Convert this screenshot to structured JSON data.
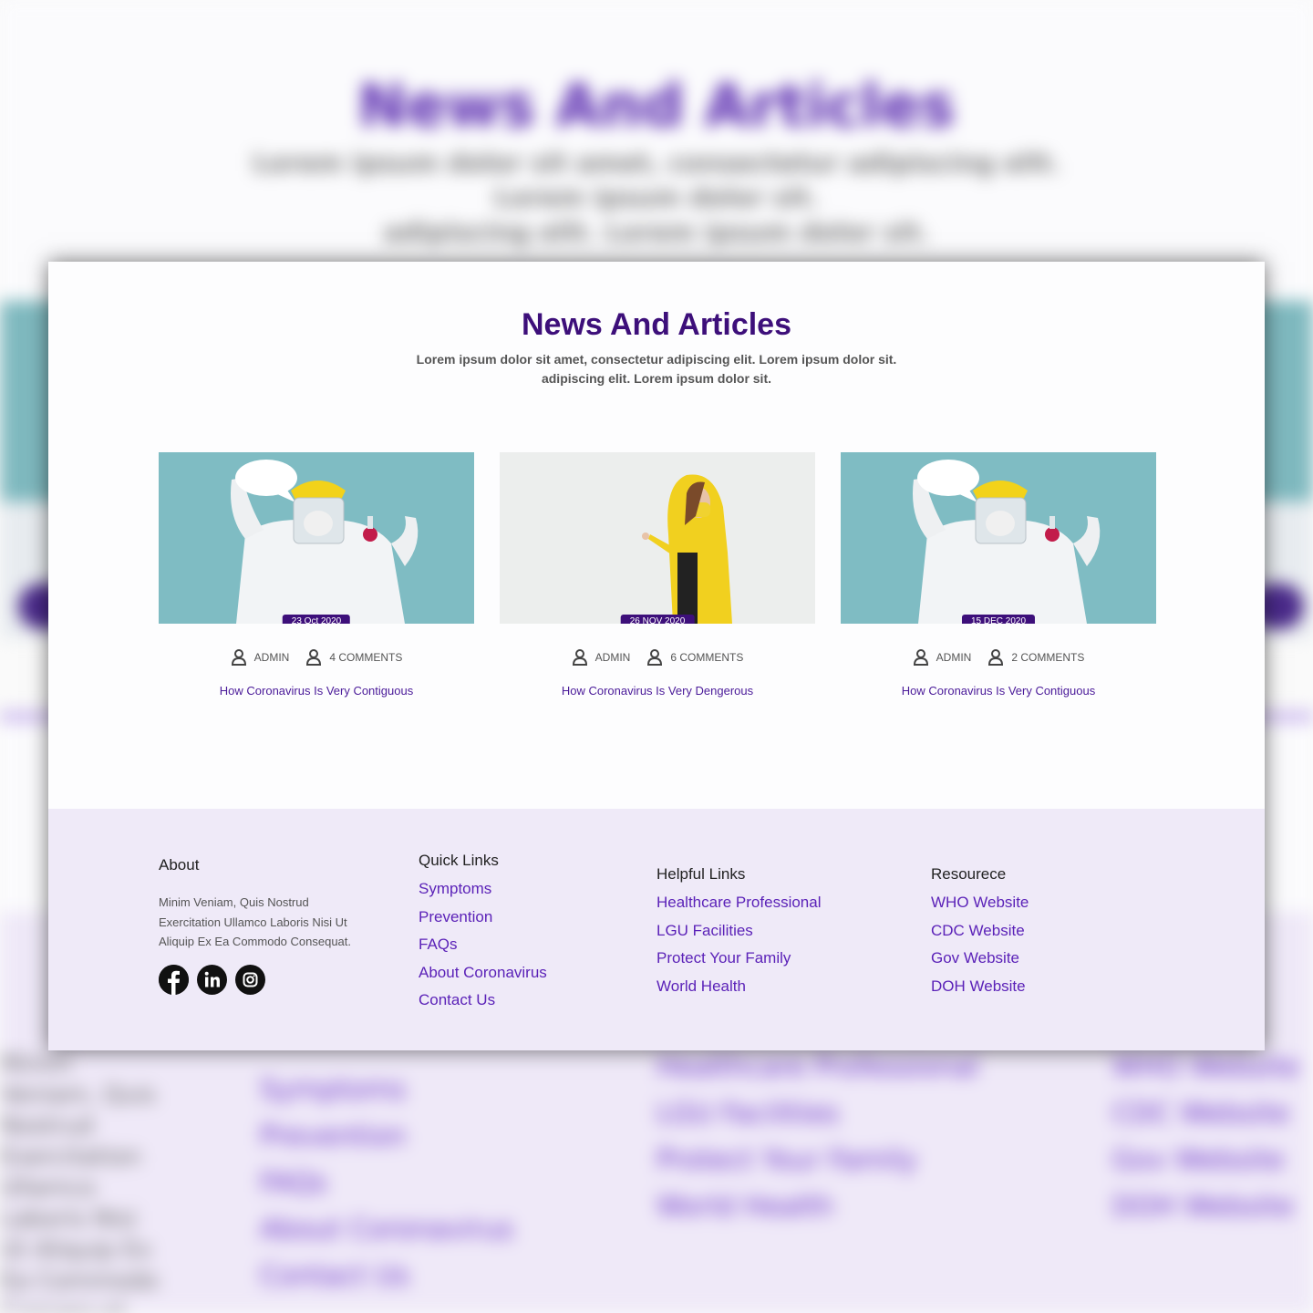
{
  "section": {
    "title": "News And Articles",
    "subtitle_line1": "Lorem ipsum dolor sit amet, consectetur adipiscing elit. Lorem ipsum dolor sit.",
    "subtitle_line2": "adipiscing elit. Lorem ipsum dolor sit."
  },
  "posts": [
    {
      "date": "23 Oct 2020",
      "author": "ADMIN",
      "comments": "4 COMMENTS",
      "title": "How Coronavirus Is Very Contiguous"
    },
    {
      "date": "26 NOV 2020",
      "author": "ADMIN",
      "comments": "6 COMMENTS",
      "title": "How Coronavirus Is Very Dengerous"
    },
    {
      "date": "15 DEC 2020",
      "author": "ADMIN",
      "comments": "2 COMMENTS",
      "title": "How Coronavirus Is Very Contiguous"
    }
  ],
  "footer": {
    "about": {
      "heading": "About",
      "text": "Minim Veniam, Quis Nostrud Exercitation Ullamco Laboris Nisi Ut Aliquip Ex Ea Commodo Consequat.",
      "socials": [
        "facebook-icon",
        "linkedin-icon",
        "instagram-icon"
      ]
    },
    "quick_links": {
      "heading": "Quick Links",
      "items": [
        "Symptoms",
        "Prevention",
        "FAQs",
        "About Coronavirus",
        "Contact Us"
      ]
    },
    "helpful_links": {
      "heading": "Helpful Links",
      "items": [
        "Healthcare Professional",
        "LGU Facilities",
        "Protect Your Family",
        "World Health"
      ]
    },
    "resource": {
      "heading": "Resourece",
      "items": [
        "WHO Website",
        "CDC Website",
        "Gov Website",
        "DOH Website"
      ]
    }
  },
  "colors": {
    "brand": "#3d0f7a",
    "link": "#5b22b8",
    "footer_bg": "#efeaf8",
    "photo_teal": "#7fbcc3"
  }
}
